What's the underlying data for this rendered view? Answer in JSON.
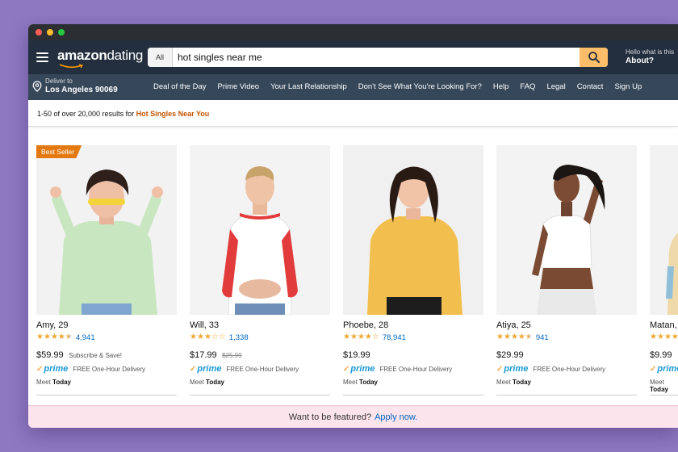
{
  "window": {
    "traffic_lights": [
      "#fe5f57",
      "#febc2e",
      "#28c840"
    ]
  },
  "header": {
    "logo_amazon": "amazon",
    "logo_dating": "dating",
    "search_category": "All",
    "search_value": "hot singles near me",
    "account_small": "Hello what is this",
    "account_big": "About?"
  },
  "subnav": {
    "deliver_label": "Deliver to",
    "deliver_location": "Los Angeles 90069",
    "links": [
      "Deal of the Day",
      "Prime Video",
      "Your Last Relationship",
      "Don't See What You're Looking For?",
      "Help",
      "FAQ",
      "Legal",
      "Contact",
      "Sign Up"
    ]
  },
  "results": {
    "prefix": "1-50 of over 20,000 results for",
    "query": "Hot Singles Near You"
  },
  "products": [
    {
      "badge": "Best Seller",
      "name": "Amy, 29",
      "stars": 4.5,
      "reviews": "4,941",
      "price": "$59.99",
      "list_price": "",
      "extra": "Subscribe & Save!",
      "delivery": "FREE One-Hour Delivery",
      "meet_prefix": "Meet",
      "meet_when": "Today"
    },
    {
      "badge": "",
      "name": "Will, 33",
      "stars": 3,
      "reviews": "1,338",
      "price": "$17.99",
      "list_price": "$25.99",
      "extra": "",
      "delivery": "FREE One-Hour Delivery",
      "meet_prefix": "Meet",
      "meet_when": "Today"
    },
    {
      "badge": "",
      "name": "Phoebe, 28",
      "stars": 4,
      "reviews": "78,941",
      "price": "$19.99",
      "list_price": "",
      "extra": "",
      "delivery": "FREE One-Hour Delivery",
      "meet_prefix": "Meet",
      "meet_when": "Today"
    },
    {
      "badge": "",
      "name": "Atiya, 25",
      "stars": 4.5,
      "reviews": "941",
      "price": "$29.99",
      "list_price": "",
      "extra": "",
      "delivery": "FREE One-Hour Delivery",
      "meet_prefix": "Meet",
      "meet_when": "Today"
    },
    {
      "badge": "",
      "name": "Matan,",
      "stars": 4,
      "reviews": "",
      "price": "$9.99",
      "list_price": "",
      "extra": "",
      "delivery": "",
      "meet_prefix": "Meet",
      "meet_when": "Today"
    }
  ],
  "prime_label": "prime",
  "banner": {
    "text": "Want to be featured?",
    "link": "Apply now."
  },
  "colors": {
    "header_bg": "#232f3e",
    "subnav_bg": "#37475a",
    "search_button": "#febd69",
    "badge": "#e47911",
    "star": "#f0a830",
    "link": "#0066c0",
    "prime": "#1a98d5",
    "banner_bg": "#fce4ec"
  }
}
